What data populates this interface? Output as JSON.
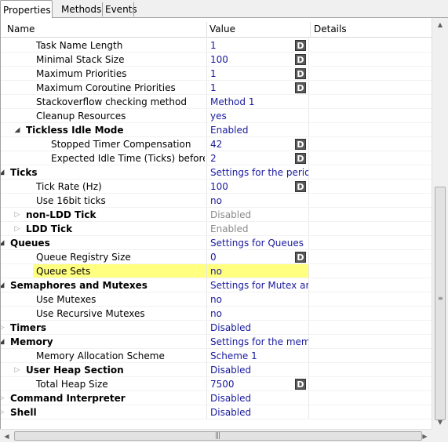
{
  "tabs": [
    {
      "label": "Properties",
      "active": true
    },
    {
      "label": "Methods",
      "active": false
    },
    {
      "label": "Events",
      "active": false
    }
  ],
  "columns": {
    "name": "Name",
    "value": "Value",
    "details": "Details"
  },
  "rows": [
    {
      "indent": 2,
      "expander": "none",
      "bold": false,
      "name": "Task Name Length",
      "value": "1",
      "value_style": "blue",
      "d": true
    },
    {
      "indent": 2,
      "expander": "none",
      "bold": false,
      "name": "Minimal Stack Size",
      "value": "100",
      "value_style": "blue",
      "d": true
    },
    {
      "indent": 2,
      "expander": "none",
      "bold": false,
      "name": "Maximum Priorities",
      "value": "1",
      "value_style": "blue",
      "d": true
    },
    {
      "indent": 2,
      "expander": "none",
      "bold": false,
      "name": "Maximum Coroutine Priorities",
      "value": "1",
      "value_style": "blue",
      "d": true
    },
    {
      "indent": 2,
      "expander": "none",
      "bold": false,
      "name": "Stackoverflow checking method",
      "value": "Method 1",
      "value_style": "blue",
      "d": false
    },
    {
      "indent": 2,
      "expander": "none",
      "bold": false,
      "name": "Cleanup Resources",
      "value": "yes",
      "value_style": "blue",
      "d": false
    },
    {
      "indent": 1,
      "expander": "open",
      "bold": true,
      "name": "Tickless Idle Mode",
      "value": "Enabled",
      "value_style": "blue",
      "d": false
    },
    {
      "indent": 3,
      "expander": "none",
      "bold": false,
      "name": "Stopped Timer Compensation",
      "value": "42",
      "value_style": "blue",
      "d": true
    },
    {
      "indent": 3,
      "expander": "none",
      "bold": false,
      "name": "Expected Idle Time (Ticks) before Sleep",
      "value": "2",
      "value_style": "blue",
      "d": true
    },
    {
      "indent": 0,
      "expander": "open",
      "bold": true,
      "name": "Ticks",
      "value": "Settings for the periodic tick timer",
      "value_style": "blue",
      "d": false
    },
    {
      "indent": 2,
      "expander": "none",
      "bold": false,
      "name": "Tick Rate (Hz)",
      "value": "100",
      "value_style": "blue",
      "d": true
    },
    {
      "indent": 2,
      "expander": "none",
      "bold": false,
      "name": "Use 16bit ticks",
      "value": "no",
      "value_style": "blue",
      "d": false
    },
    {
      "indent": 1,
      "expander": "closed",
      "bold": true,
      "name": "non-LDD Tick",
      "value": "Disabled",
      "value_style": "gray",
      "d": false
    },
    {
      "indent": 1,
      "expander": "closed",
      "bold": true,
      "name": "LDD Tick",
      "value": "Enabled",
      "value_style": "gray",
      "d": false
    },
    {
      "indent": 0,
      "expander": "open",
      "bold": true,
      "name": "Queues",
      "value": "Settings for Queues",
      "value_style": "blue",
      "d": false
    },
    {
      "indent": 2,
      "expander": "none",
      "bold": false,
      "name": "Queue Registry Size",
      "value": "0",
      "value_style": "blue",
      "d": true
    },
    {
      "indent": 2,
      "expander": "none",
      "bold": false,
      "name": "Queue Sets",
      "value": "no",
      "value_style": "blue",
      "d": false,
      "highlight": true
    },
    {
      "indent": 0,
      "expander": "open",
      "bold": true,
      "name": "Semaphores and Mutexes",
      "value": "Settings for Mutex and Semaphore",
      "value_style": "blue",
      "d": false
    },
    {
      "indent": 2,
      "expander": "none",
      "bold": false,
      "name": "Use Mutexes",
      "value": "no",
      "value_style": "blue",
      "d": false
    },
    {
      "indent": 2,
      "expander": "none",
      "bold": false,
      "name": "Use Recursive Mutexes",
      "value": "no",
      "value_style": "blue",
      "d": false
    },
    {
      "indent": 0,
      "expander": "closed",
      "bold": true,
      "name": "Timers",
      "value": "Disabled",
      "value_style": "blue",
      "d": false
    },
    {
      "indent": 0,
      "expander": "open",
      "bold": true,
      "name": "Memory",
      "value": "Settings for the memory",
      "value_style": "blue",
      "d": false
    },
    {
      "indent": 2,
      "expander": "none",
      "bold": false,
      "name": "Memory Allocation Scheme",
      "value": "Scheme 1",
      "value_style": "blue",
      "d": false
    },
    {
      "indent": 1,
      "expander": "closed",
      "bold": true,
      "name": "User Heap Section",
      "value": "Disabled",
      "value_style": "blue",
      "d": false
    },
    {
      "indent": 2,
      "expander": "none",
      "bold": false,
      "name": "Total Heap Size",
      "value": "7500",
      "value_style": "blue",
      "d": true
    },
    {
      "indent": 0,
      "expander": "closed",
      "bold": true,
      "name": "Command Interpreter",
      "value": "Disabled",
      "value_style": "blue",
      "d": false
    },
    {
      "indent": 0,
      "expander": "closed",
      "bold": true,
      "name": "Shell",
      "value": "Disabled",
      "value_style": "blue",
      "d": false
    }
  ],
  "d_label": "D",
  "icons": {
    "open": "expanded-triangle-icon",
    "closed": "collapsed-triangle-icon"
  },
  "colors": {
    "value_text": "#1a1a9e",
    "disabled_text": "#8a8a8a",
    "highlight": "#ffff80"
  }
}
